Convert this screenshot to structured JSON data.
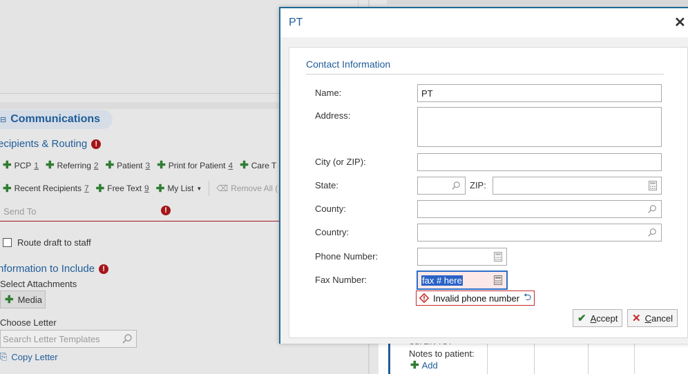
{
  "background": {
    "communications_tab": {
      "icon": "collapse-icon",
      "label": "Communications"
    },
    "recipients_routing": {
      "title": "ecipients & Routing"
    },
    "chips_row1": [
      {
        "label": "PCP",
        "key": "1"
      },
      {
        "label": "Referring",
        "key": "2"
      },
      {
        "label": "Patient",
        "key": "3"
      },
      {
        "label": "Print for Patient",
        "key": "4"
      },
      {
        "label": "Care T",
        "key": ""
      }
    ],
    "chips_row2": [
      {
        "label": "Recent Recipients",
        "key": "7"
      },
      {
        "label": "Free Text",
        "key": "9"
      },
      {
        "label": "My List",
        "key": ""
      }
    ],
    "remove_all": "Remove All (",
    "send_to_placeholder": "Send To",
    "route_draft": "Route draft to staff",
    "information_to_include": "nformation to Include",
    "select_attachments": "Select Attachments",
    "media_button": "Media",
    "choose_letter": "Choose Letter",
    "search_letter_placeholder": "Search Letter Templates",
    "copy_letter": "Copy Letter",
    "cut_text": "CSI LIN TOT",
    "notes_to_patient": "Notes to patient:",
    "add_link": "Add"
  },
  "dialog": {
    "title": "PT",
    "legend": "Contact Information",
    "fields": {
      "name": {
        "label": "Name:",
        "value": "PT"
      },
      "address": {
        "label": "Address:",
        "value": ""
      },
      "city": {
        "label": "City (or ZIP):",
        "value": ""
      },
      "state": {
        "label": "State:",
        "value": ""
      },
      "zip": {
        "label": "ZIP:",
        "value": ""
      },
      "county": {
        "label": "County:",
        "value": ""
      },
      "country": {
        "label": "Country:",
        "value": ""
      },
      "phone": {
        "label": "Phone Number:",
        "value": ""
      },
      "fax": {
        "label": "Fax Number:",
        "value": "fax # here"
      }
    },
    "error_message": "Invalid phone number",
    "accept_label": "ccept",
    "accept_underline": "A",
    "cancel_label": "ancel",
    "cancel_underline": "C"
  },
  "colors": {
    "accent": "#1f5c99",
    "error": "#a4161a",
    "success": "#2e7d32",
    "dialog_border": "#1c6a94"
  }
}
